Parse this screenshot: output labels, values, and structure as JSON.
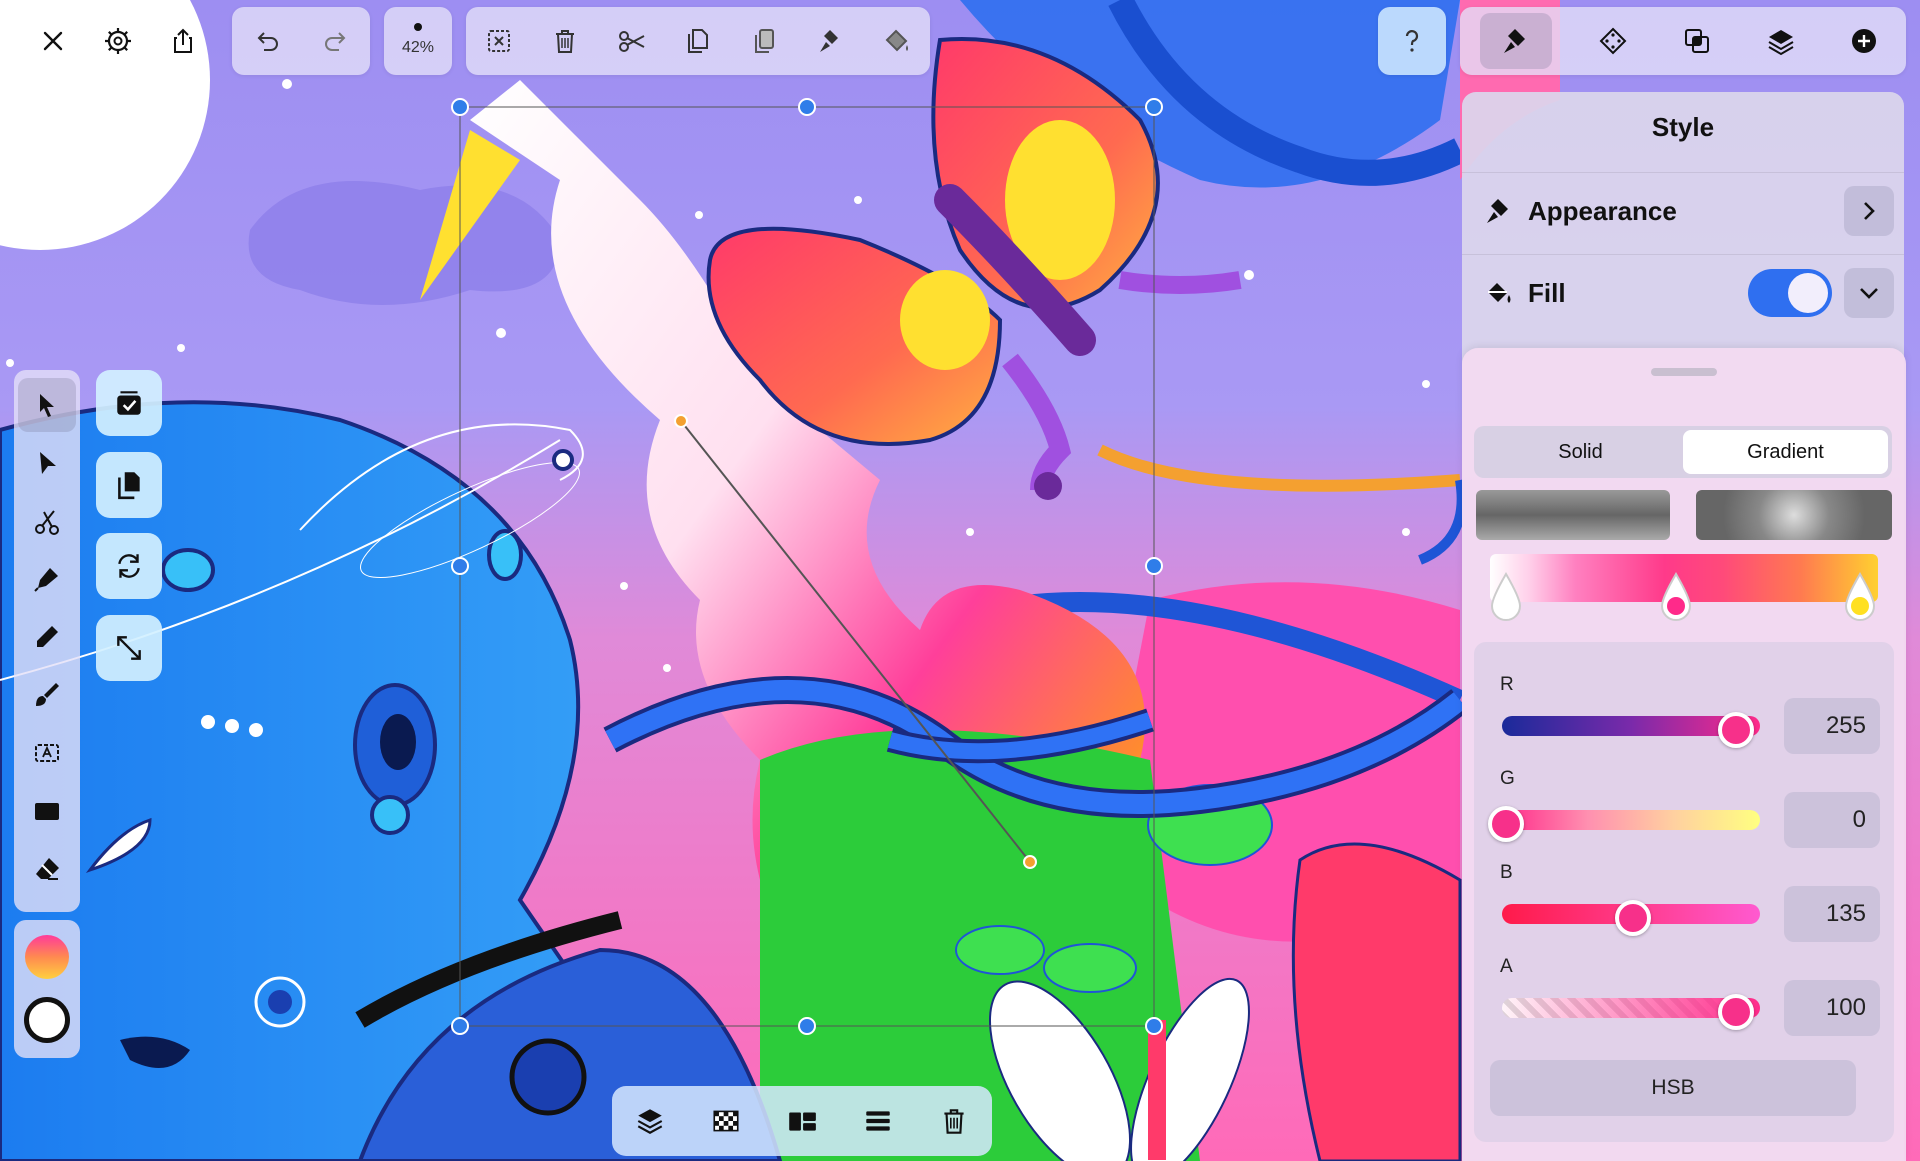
{
  "toolbar": {
    "zoom": "42%"
  },
  "panel": {
    "title": "Style",
    "appearance_label": "Appearance",
    "fill_label": "Fill",
    "fill_enabled": true
  },
  "sheet": {
    "segments": [
      "Solid",
      "Gradient"
    ],
    "selected_segment": "Gradient",
    "channels": [
      {
        "name": "R",
        "value": "255",
        "level": 0.96
      },
      {
        "name": "G",
        "value": "0",
        "level": 0.0
      },
      {
        "name": "B",
        "value": "135",
        "level": 0.53
      },
      {
        "name": "A",
        "value": "100",
        "level": 0.96
      }
    ],
    "mode_button": "HSB"
  },
  "colors": {
    "accent": "#2f6ff0",
    "selection": "#2f7de9",
    "thumb": "#f7308a"
  },
  "icons": {
    "top_left": [
      "close-icon",
      "settings-gear-icon",
      "share-icon"
    ],
    "history": [
      "undo-icon",
      "redo-icon"
    ],
    "edit": [
      "deselect-icon",
      "delete-icon",
      "cut-icon",
      "copy-icon",
      "paste-icon",
      "paste-style-icon",
      "fill-bucket-icon"
    ],
    "right": [
      "help-icon",
      "style-brush-icon",
      "symbol-icon",
      "boolean-ops-icon",
      "layers-icon",
      "add-icon"
    ],
    "tools": [
      "selection-arrow-icon",
      "direct-select-icon",
      "scissors-icon",
      "pen-icon",
      "pencil-icon",
      "brush-icon",
      "text-icon",
      "rectangle-icon",
      "eraser-icon"
    ],
    "actions": [
      "select-all-icon",
      "duplicate-icon",
      "rotate-icon",
      "resize-icon"
    ],
    "bottom": [
      "arrange-icon",
      "transparency-grid-icon",
      "align-icon",
      "distribute-icon",
      "trash-icon"
    ]
  }
}
